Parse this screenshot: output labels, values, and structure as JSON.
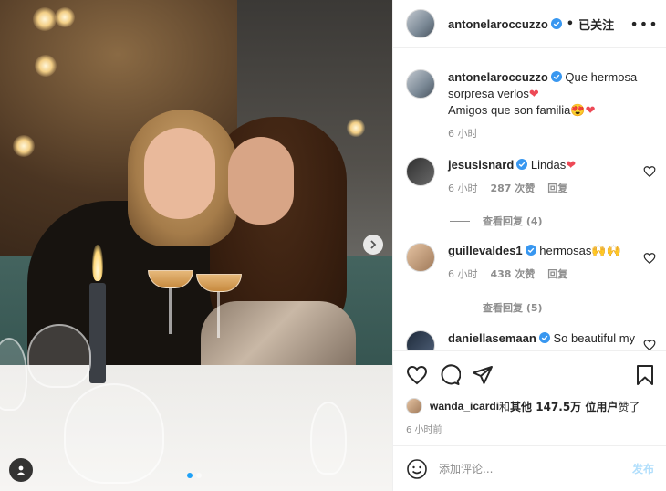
{
  "post": {
    "image_alt": "",
    "carousel": {
      "count": 2,
      "active_index": 0
    }
  },
  "header": {
    "username": "antonelaroccuzzo",
    "separator": "•",
    "follow_status": "已关注",
    "more_label": "•••"
  },
  "caption": {
    "username": "antonelaroccuzzo",
    "line1": "Que hermosa",
    "line2": "sorpresa verlos",
    "line3": "Amigos que son familia",
    "time": "6 小时"
  },
  "comments": [
    {
      "username": "jesusisnard",
      "text": "Lindas",
      "time": "6 小时",
      "likes": "287 次赞",
      "reply": "回复",
      "view_replies": "查看回复 (4)"
    },
    {
      "username": "guillevaldes1",
      "text": "hermosas",
      "time": "6 小时",
      "likes": "438 次赞",
      "reply": "回复",
      "view_replies": "查看回复 (5)"
    },
    {
      "username": "daniellasemaan",
      "text": "So beautiful my"
    }
  ],
  "likes_line": {
    "user": "wanda_icardi",
    "connector": " 和 ",
    "others": "其他 147.5万 位用户",
    "suffix": " 赞了"
  },
  "time_ago": "6 小时前",
  "comment_box": {
    "placeholder": "添加评论...",
    "post_label": "发布"
  },
  "icons": {
    "verified": "verified-badge-icon",
    "heart": "heart-icon",
    "comment": "comment-icon",
    "share": "paper-plane-icon",
    "save": "bookmark-icon",
    "emoji": "smiley-icon",
    "next": "chevron-right-icon",
    "tag": "user-tag-icon"
  },
  "colors": {
    "verified": "#3897f0",
    "heart_red": "#ed4956",
    "muted": "#8e8e8e",
    "post_button_disabled": "#b2dffc"
  }
}
